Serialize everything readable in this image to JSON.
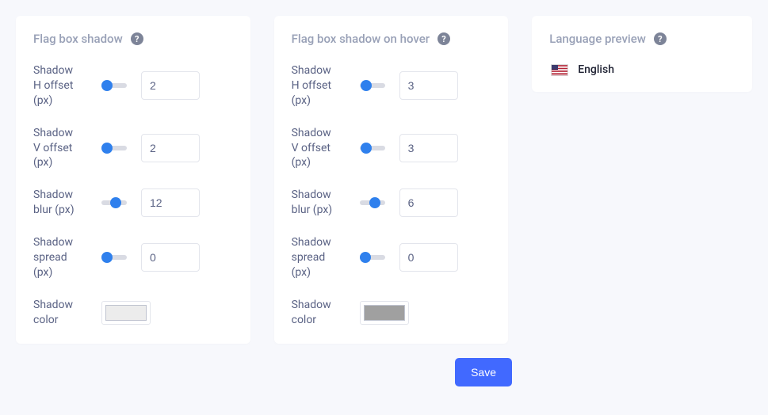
{
  "panel1": {
    "title": "Flag box shadow",
    "rows": {
      "h": {
        "label": "Shadow H offset (px)",
        "value": "2",
        "thumb_pct": 22
      },
      "v": {
        "label": "Shadow V offset (px)",
        "value": "2",
        "thumb_pct": 22
      },
      "blur": {
        "label": "Shadow blur (px)",
        "value": "12",
        "thumb_pct": 55
      },
      "spread": {
        "label": "Shadow spread (px)",
        "value": "0",
        "thumb_pct": 22
      },
      "color": {
        "label": "Shadow color",
        "swatch": "#ececec"
      }
    }
  },
  "panel2": {
    "title": "Flag box shadow on hover",
    "rows": {
      "h": {
        "label": "Shadow H offset (px)",
        "value": "3",
        "thumb_pct": 26
      },
      "v": {
        "label": "Shadow V offset (px)",
        "value": "3",
        "thumb_pct": 26
      },
      "blur": {
        "label": "Shadow blur (px)",
        "value": "6",
        "thumb_pct": 60
      },
      "spread": {
        "label": "Shadow spread (px)",
        "value": "0",
        "thumb_pct": 22
      },
      "color": {
        "label": "Shadow color",
        "swatch": "#a0a0a0"
      }
    }
  },
  "preview": {
    "title": "Language preview",
    "language": "English"
  },
  "actions": {
    "save": "Save"
  }
}
